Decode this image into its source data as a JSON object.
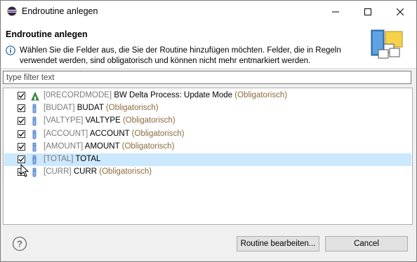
{
  "window": {
    "title": "Endroutine anlegen"
  },
  "header": {
    "title": "Endroutine anlegen",
    "message": "Wählen Sie die Felder aus, die Sie der Routine hinzufügen möchten. Felder, die in Regeln verwendet werden, sind obligatorisch und können nicht mehr entmarkiert werden."
  },
  "filter": {
    "placeholder": "type filter text",
    "value": ""
  },
  "fields": [
    {
      "tech": "[0RECORDMODE]",
      "name": "BW Delta Process: Update Mode",
      "suffix": "(Obligatorisch)",
      "checked": true,
      "icon": "key-figure-icon"
    },
    {
      "tech": "[BUDAT]",
      "name": "BUDAT",
      "suffix": "(Obligatorisch)",
      "checked": true,
      "icon": "field-icon"
    },
    {
      "tech": "[VALTYPE]",
      "name": "VALTYPE",
      "suffix": "(Obligatorisch)",
      "checked": true,
      "icon": "field-icon"
    },
    {
      "tech": "[ACCOUNT]",
      "name": "ACCOUNT",
      "suffix": "(Obligatorisch)",
      "checked": true,
      "icon": "field-icon"
    },
    {
      "tech": "[AMOUNT]",
      "name": "AMOUNT",
      "suffix": "(Obligatorisch)",
      "checked": true,
      "icon": "field-icon"
    },
    {
      "tech": "[TOTAL]",
      "name": "TOTAL",
      "suffix": "",
      "checked": true,
      "icon": "field-icon",
      "selected": true
    },
    {
      "tech": "[CURR]",
      "name": "CURR",
      "suffix": "(Obligatorisch)",
      "checked": true,
      "icon": "field-icon"
    }
  ],
  "footer": {
    "edit_button": "Routine bearbeiten...",
    "cancel_button": "Cancel"
  },
  "colors": {
    "selection": "#cce8ff",
    "obligatory_text": "#8b6b3d",
    "technical_name": "#7a7a7a"
  }
}
